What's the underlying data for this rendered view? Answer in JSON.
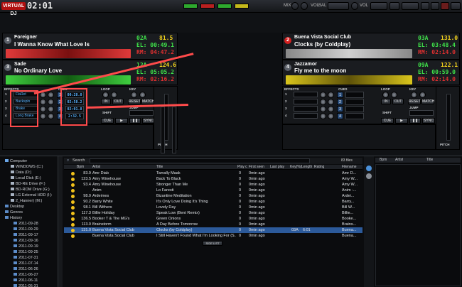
{
  "topbar": {
    "logo": "VIRTUAL DJ",
    "clock": "02:01",
    "mix_label": "MIX",
    "bal_label": "BAL",
    "vol_label": "VOL",
    "vol2_label": "VOL"
  },
  "decks": [
    {
      "num": "1",
      "num_color": "#5a5f68",
      "artist": "Foreigner",
      "title": "I Wanna Know What Love Is",
      "key": "02A",
      "bpm": "81.5",
      "elapsed": "EL: 00:49.1",
      "remain": "RM: 04:47.2",
      "wave_color": "#e03a3a"
    },
    {
      "num": "2",
      "num_color": "#d42020",
      "artist": "Buena Vista Social Club",
      "title": "Clocks (by Coldplay)",
      "key": "03A",
      "bpm": "131.0",
      "elapsed": "EL: 03:48.4",
      "remain": "RM: 02:14.0",
      "wave_color": "#c8c8c8"
    },
    {
      "num": "3",
      "num_color": "#5a5f68",
      "artist": "Sade",
      "title": "No Ordinary Love",
      "key": "12A",
      "bpm": "124.6",
      "elapsed": "EL: 05:05.2",
      "remain": "RM: 02:16.2",
      "wave_color": "#3fce3f"
    },
    {
      "num": "4",
      "num_color": "#5a5f68",
      "artist": "Jazzamor",
      "title": "Fly me to the moon",
      "key": "09A",
      "bpm": "122.1",
      "elapsed": "EL: 00:59.0",
      "remain": "RM: 02:14.0",
      "wave_color": "#d9c51c"
    }
  ],
  "controls_left": {
    "effects_label": "EFFECTS",
    "cues_label": "CUES",
    "loop_label": "LOOP",
    "key_label": "KEY",
    "range_label": "RANGE",
    "pitch_label": "PITCH",
    "in_label": "IN",
    "out_label": "OUT",
    "reset_label": "RESET",
    "match_label": "MATCH",
    "jump_label": "JUMP",
    "shift_label": "SHIFT",
    "cue_label": "CUE",
    "play_label": "▶",
    "pause_label": "❚❚",
    "sync_label": "SYNC",
    "effects": [
      "FlaRet",
      "Backspin",
      "Brake",
      "Long Brake"
    ],
    "cues": [
      "00:28.0",
      "02:58.2",
      "02:01.8",
      "",
      "",
      "2:32.5"
    ]
  },
  "controls_right": {
    "effects_label": "EFFECTS",
    "cues_label": "CUES",
    "loop_label": "LOOP",
    "key_label": "KEY",
    "range_label": "RANGE",
    "pitch_label": "PITCH",
    "in_label": "IN",
    "out_label": "OUT",
    "reset_label": "RESET",
    "match_label": "MATCH",
    "jump_label": "JUMP",
    "shift_label": "SHIFT",
    "cue_label": "CUE",
    "play_label": "▶",
    "pause_label": "❚❚",
    "sync_label": "SYNC",
    "effects": [
      "",
      "",
      "",
      ""
    ]
  },
  "browser": {
    "search_label": "Search",
    "file_count": "83 files",
    "sidelist_label": "SIDE LIST",
    "right_headers": [
      "Bpm",
      "Artist",
      "Title"
    ],
    "tree": [
      "Computer",
      "WINDOWS (C:)",
      "Data (D:)",
      "Local Disk (E:)",
      "BD-RE Drive (F:)",
      "BD-ROM Drive (G:)",
      "LG External HDD (I:)",
      "2_Hanner) (M:)",
      "Desktop",
      "Genres",
      "History",
      "2011-09-28",
      "2011-09-29",
      "2011-09-17",
      "2011-09-16",
      "2011-09-19",
      "2011-09-25",
      "2011-07-31",
      "2011-07-14",
      "2011-06-26",
      "2011-06-27",
      "2011-06-11",
      "2011-05-31",
      "2011-04-26",
      "2011-04-12"
    ],
    "headers": {
      "bpm": "Bpm",
      "artist": "Artist",
      "title": "Title",
      "plays": "Play c",
      "first": "First seen",
      "last": "Last play",
      "key": "Key(%)",
      "length": "Length",
      "rating": "Rating",
      "filename": "Filename"
    },
    "rows": [
      {
        "bpm": "83.9",
        "artist": "Amr Diab",
        "title": "Tamally Maak",
        "plays": "0",
        "first": "0min ago",
        "key": "",
        "length": "",
        "file": "Amr D..."
      },
      {
        "bpm": "123.5",
        "artist": "Amy Winehouse",
        "title": "Back To Black",
        "plays": "0",
        "first": "0min ago",
        "key": "",
        "length": "",
        "file": "Amy W..."
      },
      {
        "bpm": "93.4",
        "artist": "Amy Winehouse",
        "title": "Stronger Than Me",
        "plays": "0",
        "first": "0min ago",
        "key": "",
        "length": "",
        "file": "Amy W..."
      },
      {
        "bpm": "",
        "artist": "Anim",
        "title": "Lo Faresti",
        "plays": "0",
        "first": "0min ago",
        "key": "",
        "length": "",
        "file": "Anim -..."
      },
      {
        "bpm": "98.0",
        "artist": "Ardeimes",
        "title": "Bizantine Meditation",
        "plays": "0",
        "first": "0min ago",
        "key": "",
        "length": "",
        "file": "Ardei..."
      },
      {
        "bpm": "90.2",
        "artist": "Barry White",
        "title": "It's Only Love Doing It's Thing",
        "plays": "0",
        "first": "0min ago",
        "key": "",
        "length": "",
        "file": "Barry..."
      },
      {
        "bpm": "98.1",
        "artist": "Bill Withers",
        "title": "Lovely Day",
        "plays": "0",
        "first": "0min ago",
        "key": "",
        "length": "",
        "file": "Bill W..."
      },
      {
        "bpm": "117.3",
        "artist": "Billie Holiday",
        "title": "Speak Low (Bent Remix)",
        "plays": "0",
        "first": "0min ago",
        "key": "",
        "length": "",
        "file": "Billie..."
      },
      {
        "bpm": "136.5",
        "artist": "Booker T & The MG's",
        "title": "Green Onions",
        "plays": "0",
        "first": "0min ago",
        "key": "",
        "length": "",
        "file": "Booke..."
      },
      {
        "bpm": "113.0",
        "artist": "Brainstorm",
        "title": "A Day Before Tomorrow",
        "plays": "0",
        "first": "0min ago",
        "key": "",
        "length": "",
        "file": "Brains..."
      },
      {
        "bpm": "131.0",
        "artist": "Buena Vista Social Club",
        "title": "Clocks (by Coldplay)",
        "plays": "0",
        "first": "0min ago",
        "key": "03A",
        "length": "6:01",
        "file": "Buena..."
      },
      {
        "bpm": "",
        "artist": "Buena Vista Social Club",
        "title": "I Still Haven't Found What I'm Looking For (S...",
        "plays": "0",
        "first": "0min ago",
        "key": "",
        "length": "",
        "file": "Buena..."
      }
    ]
  }
}
